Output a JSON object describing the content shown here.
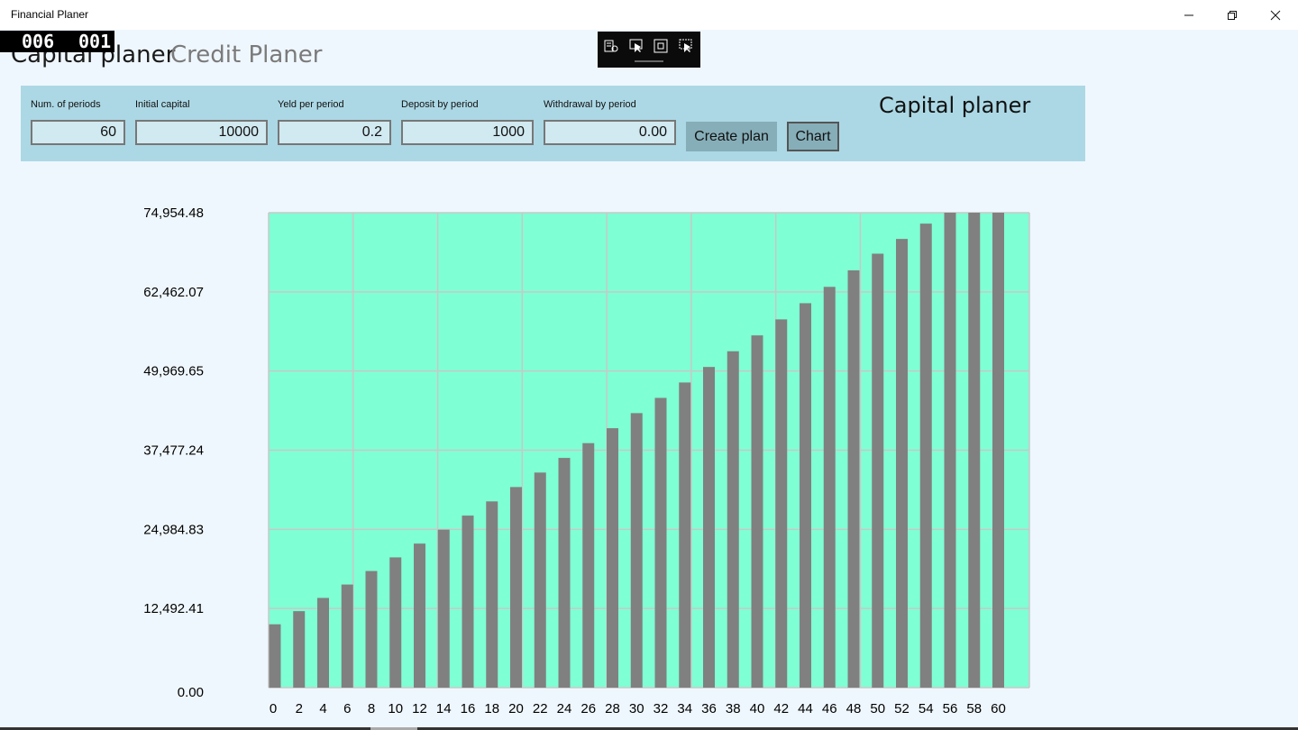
{
  "window": {
    "title": "Financial Planer",
    "minimize_icon": "minimize-icon",
    "restore_icon": "restore-icon",
    "close_icon": "close-icon"
  },
  "counter": {
    "left": "006",
    "right": "001"
  },
  "tabs": [
    {
      "label": "Capital planer",
      "active": true
    },
    {
      "label": "Credit Planer",
      "active": false
    }
  ],
  "debug_toolbar": {
    "icons": [
      "live-visual-tree-icon",
      "select-element-icon",
      "display-layout-adorners-icon",
      "track-focus-icon"
    ]
  },
  "form": {
    "title": "Capital planer",
    "fields": [
      {
        "label": "Num. of periods",
        "value": "60"
      },
      {
        "label": "Initial capital",
        "value": "10000"
      },
      {
        "label": "Yeld per period",
        "value": "0.2"
      },
      {
        "label": "Deposit by period",
        "value": "1000"
      },
      {
        "label": "Withdrawal by period",
        "value": "0.00"
      }
    ],
    "create_button": "Create plan",
    "chart_button": "Chart"
  },
  "colors": {
    "plot_background": "#7fffd4",
    "bar": "#808080",
    "grid": "#c8c8c8",
    "panel": "#acd8e5"
  },
  "chart_data": {
    "type": "bar",
    "ylim": [
      0,
      74954.48
    ],
    "y_ticks": [
      "74,954.48",
      "62,462.07",
      "49,969.65",
      "37,477.24",
      "24,984.83",
      "12,492.41",
      "0.00"
    ],
    "y_tick_values": [
      74954.48,
      62462.07,
      49969.65,
      37477.24,
      24984.83,
      12492.41,
      0
    ],
    "categories": [
      "0",
      "2",
      "4",
      "6",
      "8",
      "10",
      "12",
      "14",
      "16",
      "18",
      "20",
      "22",
      "24",
      "26",
      "28",
      "30",
      "32",
      "34",
      "36",
      "38",
      "40",
      "42",
      "44",
      "46",
      "48",
      "50",
      "52",
      "54",
      "56",
      "58",
      "60"
    ],
    "values": [
      10000,
      12070,
      14161,
      16274,
      18406,
      20561,
      22736,
      24934,
      27153,
      29395,
      31659,
      33946,
      36255,
      38588,
      40945,
      43325,
      45729,
      48158,
      50611,
      53088,
      55591,
      58118,
      60671,
      63250,
      65855,
      68486,
      70813,
      73230,
      74954.48,
      77000,
      79000
    ],
    "grid": true,
    "legend": "none"
  }
}
